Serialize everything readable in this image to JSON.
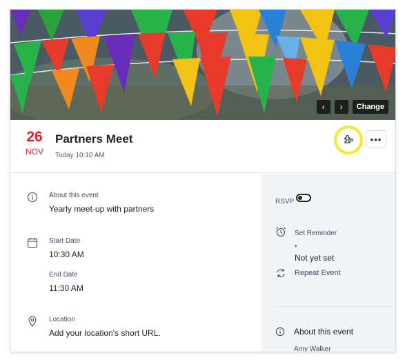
{
  "banner": {
    "prev_icon": "chevron-left-icon",
    "next_icon": "chevron-right-icon",
    "change_label": "Change"
  },
  "header": {
    "day": "26",
    "month": "NOV",
    "title": "Partners Meet",
    "subtitle": "Today 10:10 AM",
    "plugin_icon": "plugin-icon",
    "more_icon": "more-horizontal-icon",
    "accent_color": "#e0232e",
    "highlight_color": "#f3ea2a"
  },
  "details": {
    "about": {
      "label": "About this event",
      "value": "Yearly meet-up with partners"
    },
    "start": {
      "label": "Start Date",
      "value": "10:30 AM"
    },
    "end": {
      "label": "End Date",
      "value": "11:30 AM"
    },
    "location": {
      "label": "Location",
      "value": "Add your location's short URL."
    }
  },
  "sidebar": {
    "rsvp_label": "RSVP",
    "rsvp_enabled": false,
    "reminder_label": "Set Reminder",
    "reminder_value": "Not yet set",
    "repeat_label": "Repeat Event",
    "about_label": "About this event",
    "organizer": "Amy Walker"
  }
}
